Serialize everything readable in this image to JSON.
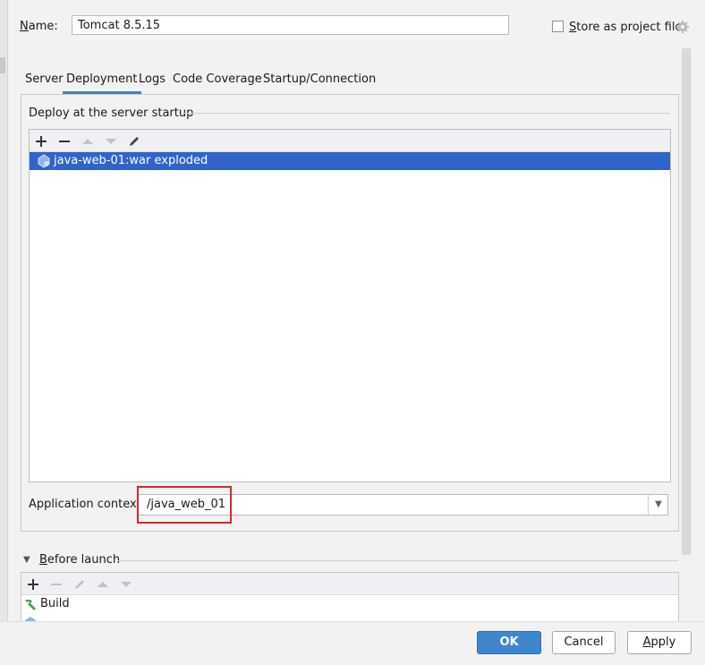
{
  "name_label": "Name:",
  "name_value": "Tomcat 8.5.15",
  "store_label": "Store as project file",
  "tabs": [
    {
      "label": "Server"
    },
    {
      "label": "Deployment",
      "active": true
    },
    {
      "label": "Logs"
    },
    {
      "label": "Code Coverage"
    },
    {
      "label": "Startup/Connection"
    }
  ],
  "deploy": {
    "section_title": "Deploy at the server startup",
    "toolbar_icons": [
      "add-icon",
      "remove-icon",
      "move-up-icon",
      "move-down-icon",
      "edit-icon"
    ],
    "items": [
      {
        "label": "java-web-01:war exploded",
        "icon": "artifact-icon",
        "selected": true
      }
    ]
  },
  "app_context": {
    "label": "Application context:",
    "value": "/java_web_01"
  },
  "before_launch": {
    "title": "Before launch",
    "toolbar_icons": [
      "add-icon",
      "remove-icon",
      "edit-icon",
      "move-up-icon",
      "move-down-icon"
    ],
    "items": [
      {
        "label": "Build",
        "icon": "hammer-icon"
      }
    ]
  },
  "buttons": {
    "ok": "OK",
    "cancel": "Cancel",
    "apply": "Apply"
  },
  "colors": {
    "accent": "#2f65ca",
    "ok_button": "#3f86cf",
    "highlight": "#d9272e",
    "tab_underline": "#4083c9"
  }
}
